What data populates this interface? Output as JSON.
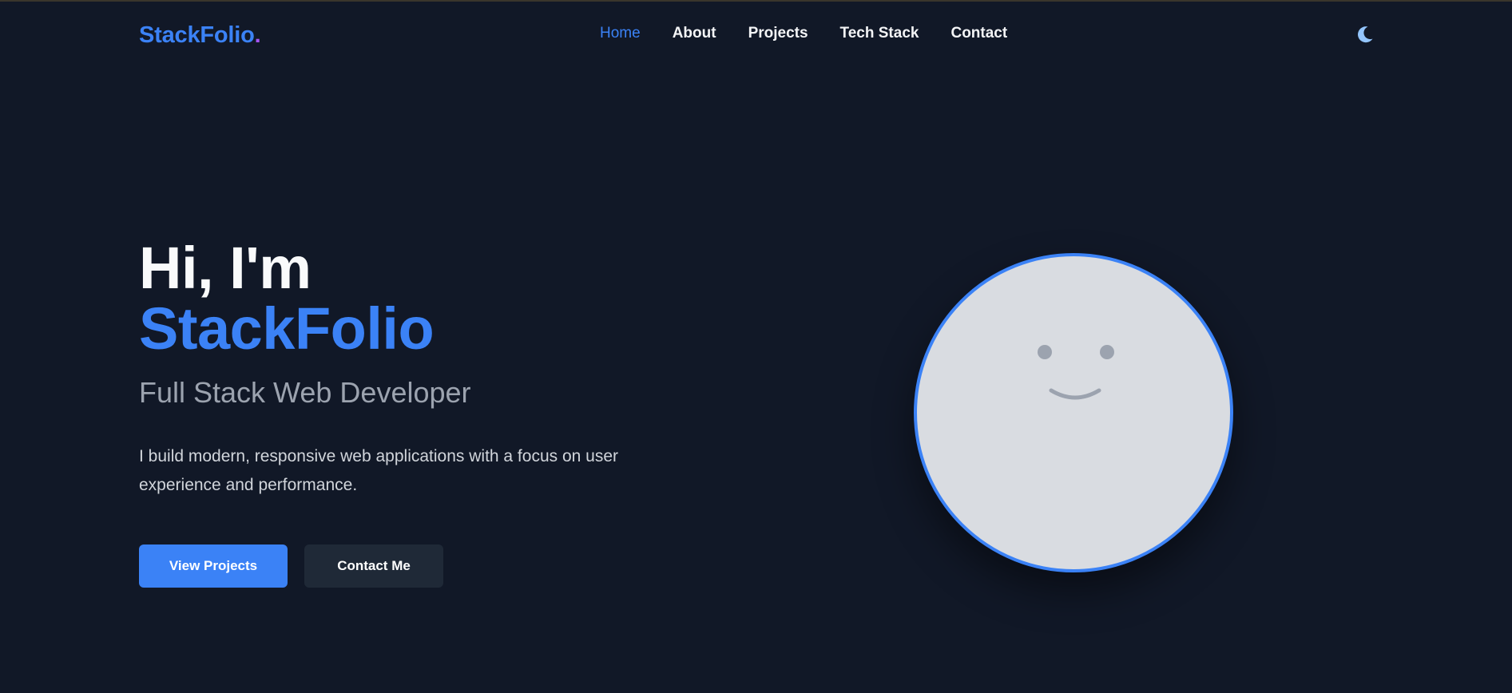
{
  "brand": {
    "name": "StackFolio",
    "dot": ".",
    "accent": "#3b82f6",
    "dot_color": "#a855f7"
  },
  "nav": {
    "items": [
      {
        "label": "Home",
        "active": true
      },
      {
        "label": "About",
        "active": false
      },
      {
        "label": "Projects",
        "active": false
      },
      {
        "label": "Tech Stack",
        "active": false
      },
      {
        "label": "Contact",
        "active": false
      }
    ],
    "theme_toggle_icon": "moon-icon"
  },
  "hero": {
    "greeting": "Hi, I'm",
    "name": "StackFolio",
    "subtitle": "Full Stack Web Developer",
    "description": "I build modern, responsive web applications with a focus on user experience and performance.",
    "buttons": {
      "primary": "View Projects",
      "secondary": "Contact Me"
    }
  },
  "avatar": {
    "icon": "smiley-face-icon"
  },
  "colors": {
    "background": "#111827",
    "accent": "#3b82f6",
    "muted_text": "#9ca3af",
    "secondary_button": "#1f2937",
    "avatar_fill": "#d9dce1"
  }
}
